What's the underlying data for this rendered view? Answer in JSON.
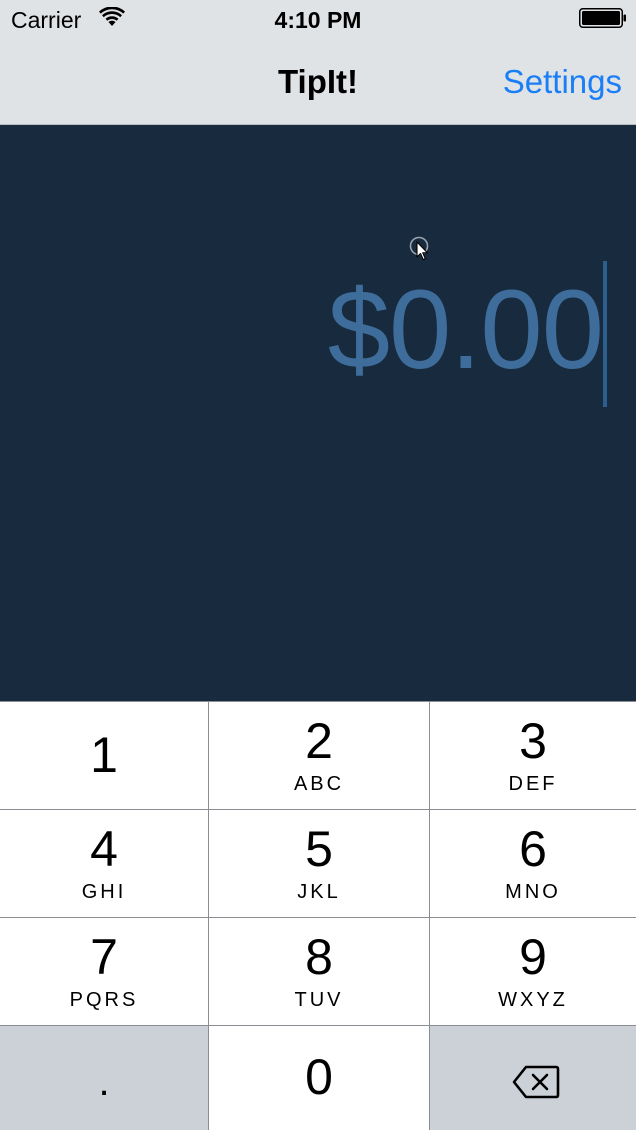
{
  "status_bar": {
    "carrier": "Carrier",
    "time": "4:10 PM",
    "wifi_icon": "wifi-icon",
    "battery_icon": "battery-icon"
  },
  "nav": {
    "title": "TipIt!",
    "settings_label": "Settings"
  },
  "bill": {
    "amount": "$0.00"
  },
  "keypad": {
    "keys": [
      {
        "digit": "1",
        "letters": ""
      },
      {
        "digit": "2",
        "letters": "ABC"
      },
      {
        "digit": "3",
        "letters": "DEF"
      },
      {
        "digit": "4",
        "letters": "GHI"
      },
      {
        "digit": "5",
        "letters": "JKL"
      },
      {
        "digit": "6",
        "letters": "MNO"
      },
      {
        "digit": "7",
        "letters": "PQRS"
      },
      {
        "digit": "8",
        "letters": "TUV"
      },
      {
        "digit": "9",
        "letters": "WXYZ"
      }
    ],
    "decimal": ".",
    "zero": "0",
    "backspace_icon": "backspace-icon"
  },
  "colors": {
    "background": "#172a3e",
    "amount_text": "#3e6d9b",
    "accent": "#1a7ef6",
    "bar": "#e0e3e6"
  }
}
